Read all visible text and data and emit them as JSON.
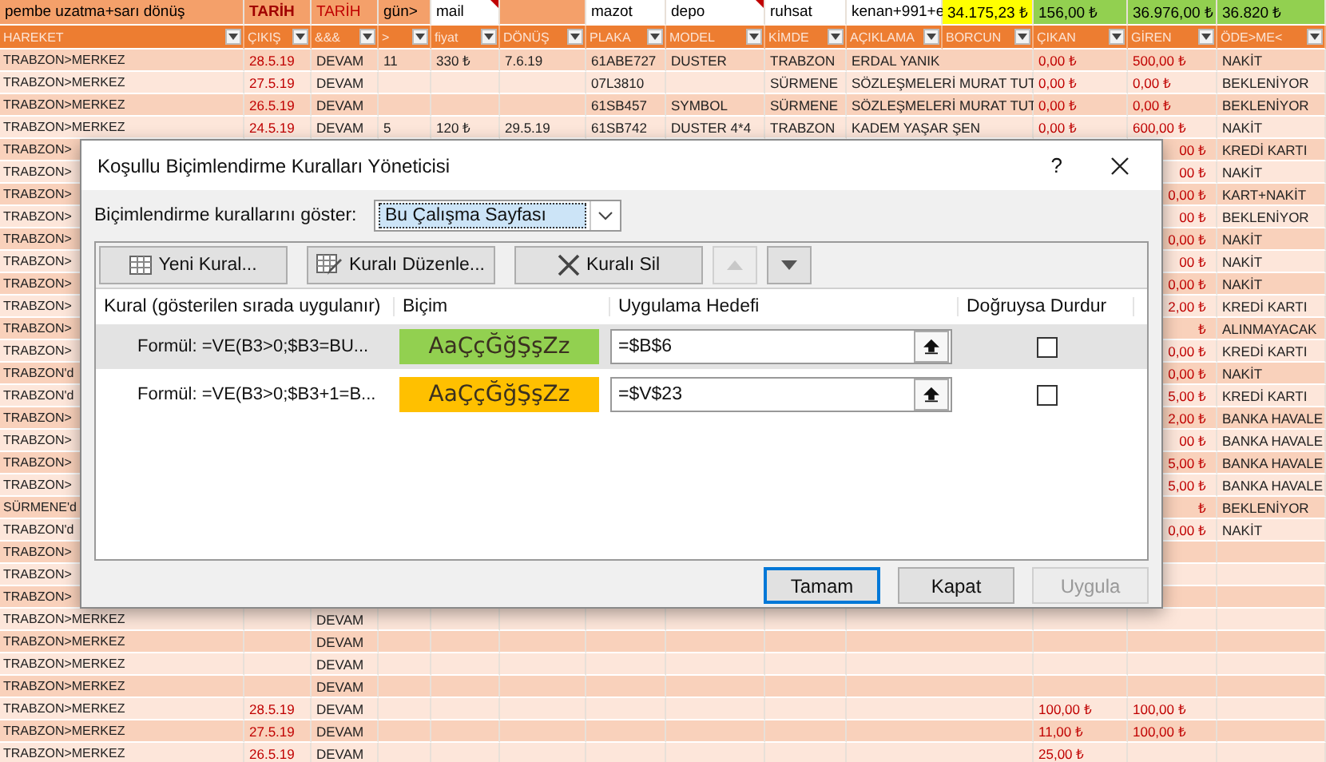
{
  "sheet": {
    "header_row_1": [
      {
        "text": "pembe uzatma+sarı dönüş",
        "kind": "plain",
        "color": "#f4a06a",
        "note": false
      },
      {
        "text": "TARİH",
        "kind": "strong",
        "color": "#f4a06a",
        "note": false
      },
      {
        "text": "TARİH",
        "kind": "alert",
        "color": "#f4a06a",
        "note": false
      },
      {
        "text": "gün>",
        "kind": "plain",
        "color": "#f4a06a",
        "note": false
      },
      {
        "text": "mail",
        "kind": "plain",
        "color": "#ffffff",
        "note": true
      },
      {
        "color": "#f4a06a",
        "note": false
      },
      {
        "text": "mazot",
        "kind": "plain",
        "color": "#ffffff",
        "note": false
      },
      {
        "text": "depo",
        "kind": "plain",
        "color": "#ffffff",
        "note": true
      },
      {
        "text": "ruhsat",
        "kind": "plain",
        "color": "#ffffff",
        "note": false
      },
      {
        "text": "kenan+991+e",
        "kind": "plain",
        "color": "#ffffff",
        "note": false
      },
      {
        "text": "34.175,23 ₺",
        "kind": "plain",
        "color": "#ffff00",
        "note": false
      },
      {
        "text": "156,00 ₺",
        "kind": "plain",
        "color": "#92d050",
        "note": false
      },
      {
        "text": "36.976,00 ₺",
        "kind": "plain",
        "color": "#92d050",
        "note": false
      },
      {
        "text": "36.820 ₺",
        "kind": "plain",
        "color": "#92d050",
        "note": false
      }
    ],
    "header_row_2": [
      "HAREKET",
      "ÇIKIŞ",
      "&&&",
      ">",
      "fiyat",
      "DÖNÜŞ",
      "PLAKA",
      "MODEL",
      "KİMDE",
      "AÇIKLAMA",
      "BORCUN",
      "ÇIKAN",
      "GİREN",
      "ÖDE>ME<"
    ],
    "rows": [
      {
        "kind": "full",
        "cells": {
          "hareket": "TRABZON>MERKEZ",
          "cikis": "28.5.19",
          "tarih": "DEVAM",
          "gun": "11",
          "fiyat": "330 ₺",
          "donus": "7.6.19",
          "plaka": "61ABE727",
          "model": "DUSTER",
          "kimde": "TRABZON",
          "aciklama": "ERDAL YANIK",
          "cikan": "0,00 ₺",
          "giren": "500,00 ₺",
          "odeme": "NAKİT"
        }
      },
      {
        "kind": "full",
        "cells": {
          "hareket": "TRABZON>MERKEZ",
          "cikis": "27.5.19",
          "tarih": "DEVAM",
          "plaka": "07L3810",
          "kimde": "SÜRMENE",
          "aciklama": "SÖZLEŞMELERİ MURAT TUT",
          "cikan": "0,00 ₺",
          "giren": "0,00 ₺",
          "odeme": "BEKLENİYOR"
        }
      },
      {
        "kind": "full",
        "cells": {
          "hareket": "TRABZON>MERKEZ",
          "cikis": "26.5.19",
          "tarih": "DEVAM",
          "plaka": "61SB457",
          "model": "SYMBOL",
          "kimde": "SÜRMENE",
          "aciklama": "SÖZLEŞMELERİ MURAT TUT",
          "cikan": "0,00 ₺",
          "giren": "0,00 ₺",
          "odeme": "BEKLENİYOR"
        }
      },
      {
        "kind": "full",
        "cells": {
          "hareket": "TRABZON>MERKEZ",
          "cikis": "24.5.19",
          "tarih": "DEVAM",
          "gun": "5",
          "fiyat": "120 ₺",
          "donus": "29.5.19",
          "plaka": "61SB742",
          "model": "DUSTER 4*4",
          "kimde": "TRABZON",
          "aciklama": "KADEM YAŞAR ŞEN",
          "cikan": "0,00 ₺",
          "giren": "600,00 ₺",
          "odeme": "NAKİT"
        }
      },
      {
        "kind": "covered",
        "cells": {
          "hareket": "TRABZON>",
          "giren": "00 ₺",
          "odeme": "KREDİ KARTI"
        }
      },
      {
        "kind": "covered",
        "cells": {
          "hareket": "TRABZON>",
          "giren": "00 ₺",
          "odeme": "NAKİT"
        }
      },
      {
        "kind": "covered",
        "cells": {
          "hareket": "TRABZON>",
          "giren": "0,00 ₺",
          "odeme": "KART+NAKİT"
        }
      },
      {
        "kind": "covered",
        "cells": {
          "hareket": "TRABZON>",
          "giren": "00 ₺",
          "odeme": "BEKLENİYOR"
        }
      },
      {
        "kind": "covered",
        "cells": {
          "hareket": "TRABZON>",
          "giren": "0,00 ₺",
          "odeme": "NAKİT"
        }
      },
      {
        "kind": "covered",
        "cells": {
          "hareket": "TRABZON>",
          "giren": "00 ₺",
          "odeme": "NAKİT"
        }
      },
      {
        "kind": "covered",
        "cells": {
          "hareket": "TRABZON>",
          "giren": "0,00 ₺",
          "odeme": "NAKİT"
        }
      },
      {
        "kind": "covered",
        "cells": {
          "hareket": "TRABZON>",
          "giren": "2,00 ₺",
          "odeme": "KREDİ KARTI"
        }
      },
      {
        "kind": "covered",
        "cells": {
          "hareket": "TRABZON>",
          "giren": "₺",
          "odeme": "ALINMAYACAK"
        }
      },
      {
        "kind": "covered",
        "cells": {
          "hareket": "TRABZON>",
          "giren": "0,00 ₺",
          "odeme": "KREDİ KARTI"
        }
      },
      {
        "kind": "covered",
        "cells": {
          "hareket": "TRABZON'd",
          "giren": "0,00 ₺",
          "odeme": "NAKİT"
        }
      },
      {
        "kind": "covered",
        "cells": {
          "hareket": "TRABZON'd",
          "giren": "5,00 ₺",
          "odeme": "KREDİ KARTI"
        }
      },
      {
        "kind": "covered",
        "cells": {
          "hareket": "TRABZON>",
          "giren": "2,00 ₺",
          "odeme": "BANKA HAVALE"
        }
      },
      {
        "kind": "covered",
        "cells": {
          "hareket": "TRABZON>",
          "giren": "00 ₺",
          "odeme": "BANKA HAVALE"
        }
      },
      {
        "kind": "covered",
        "cells": {
          "hareket": "TRABZON>",
          "giren": "5,00 ₺",
          "odeme": "BANKA HAVALE"
        }
      },
      {
        "kind": "covered",
        "cells": {
          "hareket": "TRABZON>",
          "giren": "5,00 ₺",
          "odeme": "BANKA HAVALE"
        }
      },
      {
        "kind": "covered",
        "cells": {
          "hareket": "SÜRMENE'd",
          "giren": "₺",
          "odeme": "BEKLENİYOR"
        }
      },
      {
        "kind": "covered",
        "cells": {
          "hareket": "TRABZON'd",
          "giren": "0,00 ₺",
          "odeme": "NAKİT"
        }
      },
      {
        "kind": "covered",
        "cells": {
          "hareket": "TRABZON>"
        }
      },
      {
        "kind": "covered",
        "cells": {
          "hareket": "TRABZON>"
        }
      },
      {
        "kind": "covered",
        "cells": {
          "hareket": "TRABZON>"
        }
      },
      {
        "kind": "full",
        "cells": {
          "hareket": "TRABZON>MERKEZ",
          "tarih": "DEVAM"
        }
      },
      {
        "kind": "full",
        "cells": {
          "hareket": "TRABZON>MERKEZ",
          "tarih": "DEVAM"
        }
      },
      {
        "kind": "full",
        "cells": {
          "hareket": "TRABZON>MERKEZ",
          "tarih": "DEVAM"
        }
      },
      {
        "kind": "full",
        "cells": {
          "hareket": "TRABZON>MERKEZ",
          "tarih": "DEVAM"
        }
      },
      {
        "kind": "full",
        "cells": {
          "hareket": "TRABZON>MERKEZ",
          "cikis": "28.5.19",
          "tarih": "DEVAM",
          "cikan": "100,00 ₺",
          "giren": "100,00 ₺"
        }
      },
      {
        "kind": "full",
        "cells": {
          "hareket": "TRABZON>MERKEZ",
          "cikis": "27.5.19",
          "tarih": "DEVAM",
          "cikan": "11,00 ₺",
          "giren": "100,00 ₺"
        }
      },
      {
        "kind": "full",
        "cells": {
          "hareket": "TRABZON>MERKEZ",
          "cikis": "26.5.19",
          "tarih": "DEVAM",
          "cikan": "25,00 ₺"
        }
      }
    ]
  },
  "dialog": {
    "title": "Koşullu Biçimlendirme Kuralları Yöneticisi",
    "help": "?",
    "show_label": "Biçimlendirme kurallarını göster:",
    "show_value": "Bu Çalışma Sayfası",
    "toolbar": [
      {
        "kind": "new",
        "label": "Yeni Kural..."
      },
      {
        "kind": "edit",
        "label": "Kuralı Düzenle..."
      },
      {
        "kind": "delete",
        "label": "Kuralı Sil"
      }
    ],
    "move_buttons": [
      {
        "kind": "up",
        "disabled": true
      },
      {
        "kind": "down",
        "disabled": false
      }
    ],
    "columns": [
      "Kural (gösterilen sırada uygulanır)",
      "Biçim",
      "Uygulama Hedefi",
      "Doğruysa Durdur"
    ],
    "rules": [
      {
        "rule": "Formül: =VE(B3>0;$B3=BU...",
        "preview": "AaÇçĞğŞşZz",
        "color": "#92d050",
        "applies_to": "=$B$6",
        "stop_if_true": false,
        "selected": true
      },
      {
        "rule": "Formül: =VE(B3>0;$B3+1=B...",
        "preview": "AaÇçĞğŞşZz",
        "color": "#ffc000",
        "applies_to": "=$V$23",
        "stop_if_true": false,
        "selected": false
      }
    ],
    "buttons": [
      {
        "label": "Tamam",
        "kind": "default",
        "disabled": false
      },
      {
        "label": "Kapat",
        "kind": "normal",
        "disabled": false
      },
      {
        "label": "Uygula",
        "kind": "normal",
        "disabled": true
      }
    ]
  }
}
